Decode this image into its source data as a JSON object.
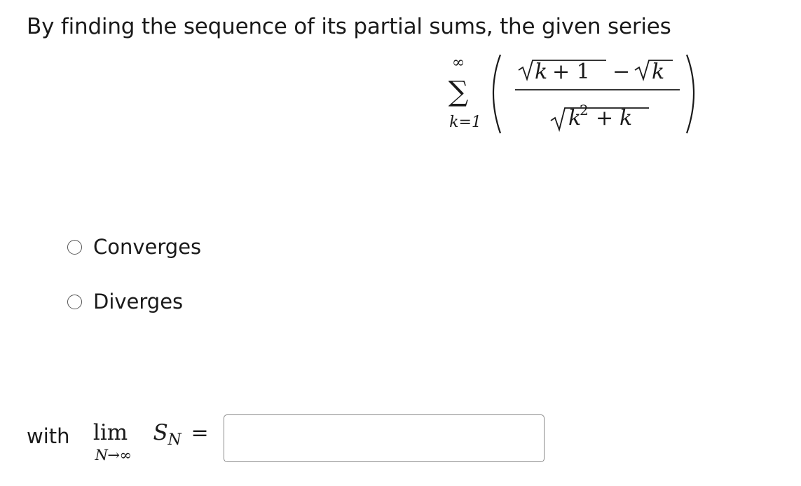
{
  "question": {
    "prompt": "By finding the sequence of its partial sums, the given series"
  },
  "series": {
    "sum_upper": "∞",
    "sum_lower": "k=1",
    "numerator": "√k + 1 − √k",
    "denominator": "√k² + k"
  },
  "options": [
    {
      "label": "Converges",
      "selected": false
    },
    {
      "label": "Diverges",
      "selected": false
    }
  ],
  "answer": {
    "with_label": "with",
    "lim": "lim",
    "lim_sub": "N→∞",
    "s": "S",
    "s_sub": "N",
    "equals": "=",
    "value": ""
  },
  "colors": {
    "text": "#1a1a1a",
    "input_border": "#8a8a8a",
    "radio_border": "#555555"
  }
}
